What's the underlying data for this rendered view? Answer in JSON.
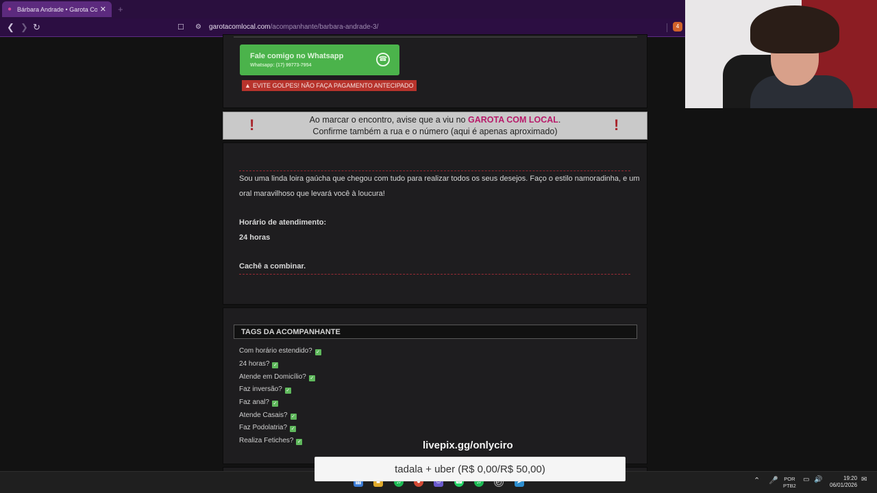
{
  "browser": {
    "tab_title": "Bárbara Andrade • Garota Com",
    "url_domain": "garotacomlocal.com",
    "url_path": "/acompanhante/barbara-andrade-3/",
    "extension_badge": "4"
  },
  "whatsapp": {
    "main": "Fale comigo no Whatsapp",
    "sub": "Whatsapp: (17) 99773-7954"
  },
  "warning": "EVITE GOLPES! NÃO FAÇA PAGAMENTO ANTECIPADO",
  "notice": {
    "line1_pre": "Ao marcar o encontro, avise que a viu no ",
    "brand": "GAROTA COM LOCAL",
    "line1_post": ".",
    "line2": "Confirme também a rua e o número (aqui é apenas aproximado)"
  },
  "description": {
    "line1": "Sou uma linda loira gaúcha que chegou com tudo para realizar todos os seus desejos. Faço o estilo namoradinha, e um",
    "line2": "oral maravilhoso que levará você à loucura!",
    "hours_label": "Horário de atendimento:",
    "hours_value": "24 horas",
    "cache": "Cachê a combinar."
  },
  "tags": {
    "heading": "TAGS DA ACOMPANHANTE",
    "items": [
      "Com horário estendido?",
      "24 horas?",
      "Atende em Domicílio?",
      "Faz inversão?",
      "Faz anal?",
      "Atende Casais?",
      "Faz Podolatria?",
      "Realiza Fetiches?"
    ]
  },
  "overlay": {
    "livepix": "livepix.gg/onlyciro",
    "goal": "tadala + uber (R$ 0,00/R$ 50,00)"
  },
  "taskbar": {
    "lang1": "POR",
    "lang2": "PTB2",
    "time": "19:20",
    "date": "06/01/2026"
  },
  "colors": {
    "tab_bg": "#5c2a7e",
    "whatsapp_green": "#4bb34b",
    "warning_red": "#b7332c",
    "brand_pink": "#b81a6a"
  }
}
